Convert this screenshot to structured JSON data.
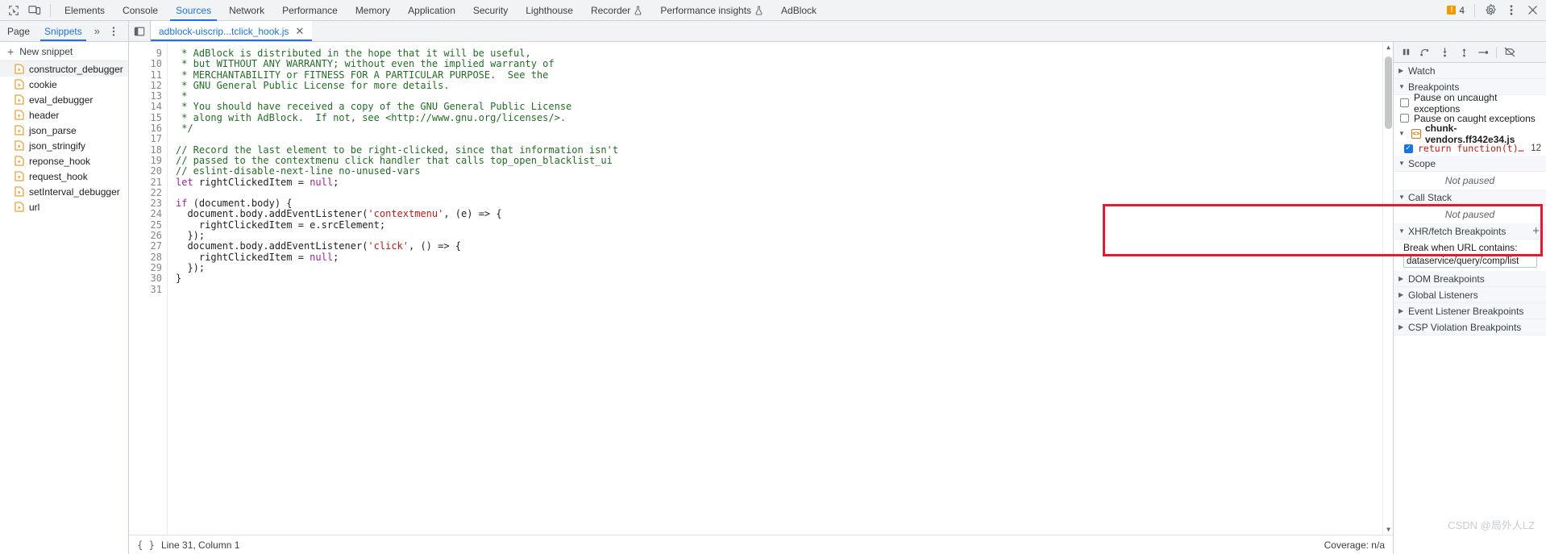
{
  "toolbar": {
    "inspect_icon": "inspect-element-icon",
    "device_icon": "device-toolbar-icon",
    "tabs": [
      {
        "label": "Elements",
        "active": false,
        "flask": false
      },
      {
        "label": "Console",
        "active": false,
        "flask": false
      },
      {
        "label": "Sources",
        "active": true,
        "flask": false
      },
      {
        "label": "Network",
        "active": false,
        "flask": false
      },
      {
        "label": "Performance",
        "active": false,
        "flask": false
      },
      {
        "label": "Memory",
        "active": false,
        "flask": false
      },
      {
        "label": "Application",
        "active": false,
        "flask": false
      },
      {
        "label": "Security",
        "active": false,
        "flask": false
      },
      {
        "label": "Lighthouse",
        "active": false,
        "flask": false
      },
      {
        "label": "Recorder",
        "active": false,
        "flask": true
      },
      {
        "label": "Performance insights",
        "active": false,
        "flask": true
      },
      {
        "label": "AdBlock",
        "active": false,
        "flask": false
      }
    ],
    "warning_count": "4",
    "warning_glyph": "!",
    "settings_icon": "gear-icon",
    "more_icon": "kebab-menu-icon",
    "close_icon": "close-icon"
  },
  "subbar": {
    "nav_tabs": [
      {
        "label": "Page",
        "active": false
      },
      {
        "label": "Snippets",
        "active": true
      }
    ],
    "more_glyph": "»",
    "kebab_glyph": "⋮",
    "panel_toggle_icon": "show-navigator-icon",
    "file_tab": {
      "label": "adblock-uiscrip...tclick_hook.js",
      "close_glyph": "✕"
    }
  },
  "snippets": {
    "new_snippet_label": "New snippet",
    "plus_glyph": "+",
    "items": [
      {
        "label": "constructor_debugger",
        "selected": true
      },
      {
        "label": "cookie",
        "selected": false
      },
      {
        "label": "eval_debugger",
        "selected": false
      },
      {
        "label": "header",
        "selected": false
      },
      {
        "label": "json_parse",
        "selected": false
      },
      {
        "label": "json_stringify",
        "selected": false
      },
      {
        "label": "reponse_hook",
        "selected": false
      },
      {
        "label": "request_hook",
        "selected": false
      },
      {
        "label": "setInterval_debugger",
        "selected": false
      },
      {
        "label": "url",
        "selected": false
      }
    ]
  },
  "editor": {
    "first_line": 9,
    "lines": [
      {
        "n": 9,
        "segments": [
          {
            "t": " * AdBlock is distributed in the hope that it will be useful,",
            "c": "cmt"
          }
        ]
      },
      {
        "n": 10,
        "segments": [
          {
            "t": " * but WITHOUT ANY WARRANTY; without even the implied warranty of",
            "c": "cmt"
          }
        ]
      },
      {
        "n": 11,
        "segments": [
          {
            "t": " * MERCHANTABILITY or FITNESS FOR A PARTICULAR PURPOSE.  See the",
            "c": "cmt"
          }
        ]
      },
      {
        "n": 12,
        "segments": [
          {
            "t": " * GNU General Public License for more details.",
            "c": "cmt"
          }
        ]
      },
      {
        "n": 13,
        "segments": [
          {
            "t": " *",
            "c": "cmt"
          }
        ]
      },
      {
        "n": 14,
        "segments": [
          {
            "t": " * You should have received a copy of the GNU General Public License",
            "c": "cmt"
          }
        ]
      },
      {
        "n": 15,
        "segments": [
          {
            "t": " * along with AdBlock.  If not, see <http://www.gnu.org/licenses/>.",
            "c": "cmt"
          }
        ]
      },
      {
        "n": 16,
        "segments": [
          {
            "t": " */",
            "c": "cmt"
          }
        ]
      },
      {
        "n": 17,
        "segments": [
          {
            "t": "",
            "c": ""
          }
        ]
      },
      {
        "n": 18,
        "segments": [
          {
            "t": "// Record the last element to be right-clicked, since that information isn't",
            "c": "cmt"
          }
        ]
      },
      {
        "n": 19,
        "segments": [
          {
            "t": "// passed to the contextmenu click handler that calls top_open_blacklist_ui",
            "c": "cmt"
          }
        ]
      },
      {
        "n": 20,
        "segments": [
          {
            "t": "// eslint-disable-next-line no-unused-vars",
            "c": "cmt"
          }
        ]
      },
      {
        "n": 21,
        "segments": [
          {
            "t": "let",
            "c": "kw"
          },
          {
            "t": " rightClickedItem = ",
            "c": ""
          },
          {
            "t": "null",
            "c": "kw"
          },
          {
            "t": ";",
            "c": ""
          }
        ]
      },
      {
        "n": 22,
        "segments": [
          {
            "t": "",
            "c": ""
          }
        ]
      },
      {
        "n": 23,
        "segments": [
          {
            "t": "if",
            "c": "kw"
          },
          {
            "t": " (document.body) {",
            "c": ""
          }
        ]
      },
      {
        "n": 24,
        "segments": [
          {
            "t": "  document.body.addEventListener(",
            "c": ""
          },
          {
            "t": "'contextmenu'",
            "c": "str"
          },
          {
            "t": ", (e) => {",
            "c": ""
          }
        ]
      },
      {
        "n": 25,
        "segments": [
          {
            "t": "    rightClickedItem = e.srcElement;",
            "c": ""
          }
        ]
      },
      {
        "n": 26,
        "segments": [
          {
            "t": "  });",
            "c": ""
          }
        ]
      },
      {
        "n": 27,
        "segments": [
          {
            "t": "  document.body.addEventListener(",
            "c": ""
          },
          {
            "t": "'click'",
            "c": "str"
          },
          {
            "t": ", () => {",
            "c": ""
          }
        ]
      },
      {
        "n": 28,
        "segments": [
          {
            "t": "    rightClickedItem = ",
            "c": ""
          },
          {
            "t": "null",
            "c": "kw"
          },
          {
            "t": ";",
            "c": ""
          }
        ]
      },
      {
        "n": 29,
        "segments": [
          {
            "t": "  });",
            "c": ""
          }
        ]
      },
      {
        "n": 30,
        "segments": [
          {
            "t": "}",
            "c": ""
          }
        ]
      },
      {
        "n": 31,
        "segments": [
          {
            "t": "",
            "c": ""
          }
        ]
      }
    ]
  },
  "statusbar": {
    "format_glyph": "{ }",
    "position": "Line 31, Column 1",
    "coverage": "Coverage: n/a"
  },
  "debugger": {
    "controls": [
      {
        "name": "pause-script-execution-icon",
        "title": "Pause"
      },
      {
        "name": "step-over-icon",
        "title": "Step over next function call"
      },
      {
        "name": "step-into-icon",
        "title": "Step into next function call"
      },
      {
        "name": "step-out-icon",
        "title": "Step out of current function"
      },
      {
        "name": "step-icon",
        "title": "Step"
      },
      {
        "name": "deactivate-breakpoints-icon",
        "title": "Deactivate breakpoints"
      }
    ],
    "sections": {
      "watch": {
        "label": "Watch",
        "expanded": false
      },
      "breakpoints": {
        "label": "Breakpoints",
        "expanded": true,
        "pause_uncaught": {
          "label": "Pause on uncaught exceptions",
          "checked": false
        },
        "pause_caught": {
          "label": "Pause on caught exceptions",
          "checked": false
        },
        "file": "chunk-vendors.ff342e34.js",
        "entries": [
          {
            "code": "return function(t){v…",
            "line": "12",
            "checked": true
          }
        ]
      },
      "scope": {
        "label": "Scope",
        "expanded": true,
        "empty_text": "Not paused"
      },
      "call_stack": {
        "label": "Call Stack",
        "expanded": true,
        "empty_text": "Not paused"
      },
      "xhr": {
        "label": "XHR/fetch Breakpoints",
        "expanded": true,
        "add_glyph": "+",
        "field_label": "Break when URL contains:",
        "field_value": "dataservice/query/comp/list"
      },
      "dom_breakpoints": {
        "label": "DOM Breakpoints",
        "expanded": false
      },
      "global_listeners": {
        "label": "Global Listeners",
        "expanded": false
      },
      "event_listener_breakpoints": {
        "label": "Event Listener Breakpoints",
        "expanded": false
      },
      "csp_violation_breakpoints": {
        "label": "CSP Violation Breakpoints",
        "expanded": false
      }
    }
  },
  "annotation": {
    "highlight_color": "#e8192c"
  },
  "watermark": {
    "text": "CSDN @局外人LZ"
  }
}
